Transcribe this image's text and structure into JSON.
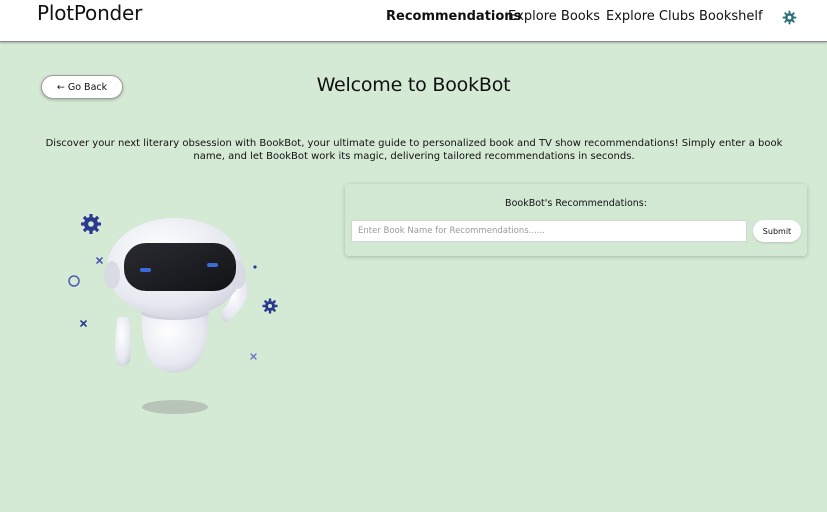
{
  "header": {
    "brand": "PlotPonder",
    "nav": [
      {
        "label": "Recommendations",
        "active": true
      },
      {
        "label": "Explore Books",
        "active": false
      },
      {
        "label": "Explore Clubs",
        "active": false
      },
      {
        "label": "Bookshelf",
        "active": false
      }
    ],
    "settings_icon": "gear-icon"
  },
  "main": {
    "go_back_label": "← Go Back",
    "title": "Welcome to BookBot",
    "intro": "Discover your next literary obsession with BookBot, your ultimate guide to personalized book and TV show recommendations! Simply enter a book name, and let BookBot work its magic, delivering tailored recommendations in seconds."
  },
  "recommend_panel": {
    "title": "BookBot's Recommendations:",
    "input_value": "",
    "input_placeholder": "Enter Book Name for Recommendations......",
    "submit_label": "Submit"
  },
  "illustration": {
    "icon": "robot-illustration",
    "decorations": [
      "gear-icon",
      "gear-icon",
      "circle-icon",
      "cross-icon",
      "dot-icon"
    ]
  },
  "colors": {
    "page_background": "#d5ead5",
    "header_background": "#ffffff",
    "accent_gear": "#2a3a8f",
    "robot_visor": "#1e1f24",
    "robot_eyes": "#3a6bd6"
  }
}
